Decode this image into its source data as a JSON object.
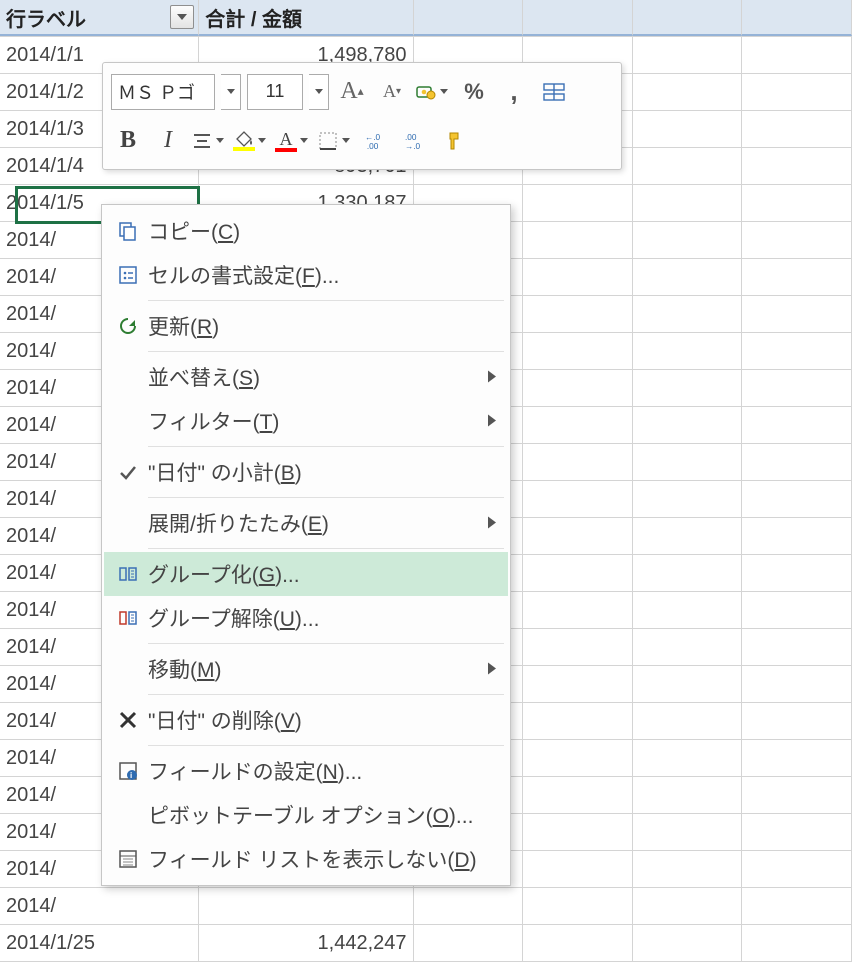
{
  "sheet": {
    "header": {
      "colA": "行ラベル",
      "colB": "合計 / 金額"
    },
    "rows": [
      {
        "a": "2014/1/1",
        "b": "1,498,780"
      },
      {
        "a": "2014/1/2",
        "b": ""
      },
      {
        "a": "2014/1/3",
        "b": ""
      },
      {
        "a": "2014/1/4",
        "b": "893,761"
      },
      {
        "a": "2014/1/5",
        "b": "1,330,187"
      },
      {
        "a": "2014/",
        "b": ""
      },
      {
        "a": "2014/",
        "b": ""
      },
      {
        "a": "2014/",
        "b": ""
      },
      {
        "a": "2014/",
        "b": ""
      },
      {
        "a": "2014/",
        "b": ""
      },
      {
        "a": "2014/",
        "b": ""
      },
      {
        "a": "2014/",
        "b": ""
      },
      {
        "a": "2014/",
        "b": ""
      },
      {
        "a": "2014/",
        "b": ""
      },
      {
        "a": "2014/",
        "b": ""
      },
      {
        "a": "2014/",
        "b": ""
      },
      {
        "a": "2014/",
        "b": ""
      },
      {
        "a": "2014/",
        "b": ""
      },
      {
        "a": "2014/",
        "b": ""
      },
      {
        "a": "2014/",
        "b": ""
      },
      {
        "a": "2014/",
        "b": ""
      },
      {
        "a": "2014/",
        "b": ""
      },
      {
        "a": "2014/",
        "b": ""
      },
      {
        "a": "2014/",
        "b": ""
      },
      {
        "a": "2014/1/25",
        "b": "1,442,247"
      }
    ],
    "selected_cell": "2014/1/5"
  },
  "mini_toolbar": {
    "font_name": "ＭＳ Ｐゴ",
    "font_size": "11"
  },
  "context_menu": {
    "items": {
      "copy": "コピー(C)",
      "format_cells": "セルの書式設定(F)...",
      "refresh": "更新(R)",
      "sort": "並べ替え(S)",
      "filter": "フィルター(T)",
      "subtotal": "\"日付\" の小計(B)",
      "expand": "展開/折りたたみ(E)",
      "group": "グループ化(G)...",
      "ungroup": "グループ解除(U)...",
      "move": "移動(M)",
      "remove": "\"日付\" の削除(V)",
      "field_settings": "フィールドの設定(N)...",
      "pt_options": "ピボットテーブル オプション(O)...",
      "hide_fieldlist": "フィールド リストを表示しない(D)"
    },
    "hovered": "group"
  }
}
